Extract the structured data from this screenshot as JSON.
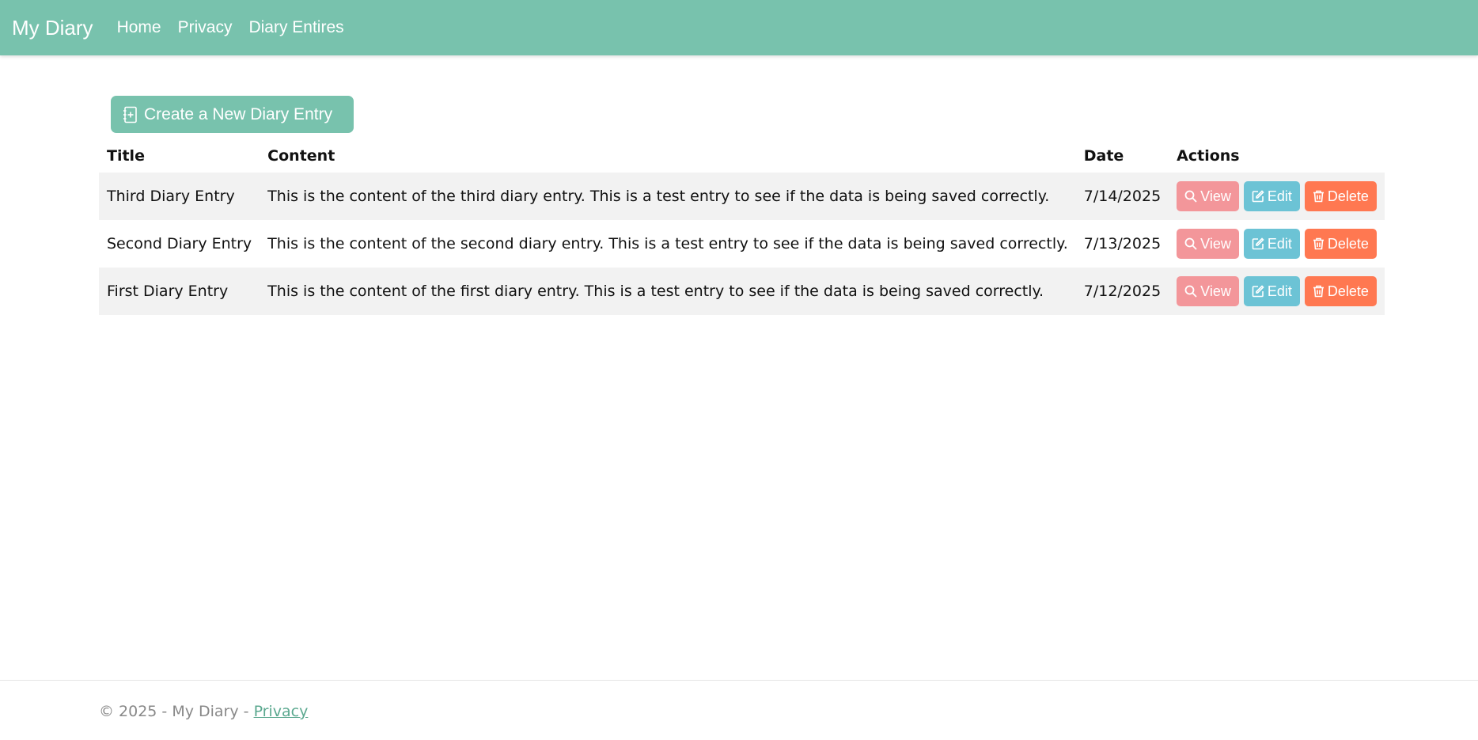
{
  "navbar": {
    "brand": "My Diary",
    "links": [
      "Home",
      "Privacy",
      "Diary Entires"
    ]
  },
  "create_button": {
    "label": "Create a New Diary Entry",
    "icon": "journal-plus-icon"
  },
  "table": {
    "headers": {
      "title": "Title",
      "content": "Content",
      "date": "Date",
      "actions": "Actions"
    },
    "rows": [
      {
        "title": "Third Diary Entry",
        "content": "This is the content of the third diary entry. This is a test entry to see if the data is being saved correctly.",
        "date": "7/14/2025"
      },
      {
        "title": "Second Diary Entry",
        "content": "This is the content of the second diary entry. This is a test entry to see if the data is being saved correctly.",
        "date": "7/13/2025"
      },
      {
        "title": "First Diary Entry",
        "content": "This is the content of the first diary entry. This is a test entry to see if the data is being saved correctly.",
        "date": "7/12/2025"
      }
    ],
    "actions": {
      "view": "View",
      "edit": "Edit",
      "delete": "Delete"
    }
  },
  "footer": {
    "text": "© 2025 - My Diary - ",
    "privacy_link": "Privacy"
  },
  "colors": {
    "primary": "#78c2ad",
    "view": "#f3969a",
    "edit": "#6cc3d5",
    "delete": "#ff7851"
  }
}
